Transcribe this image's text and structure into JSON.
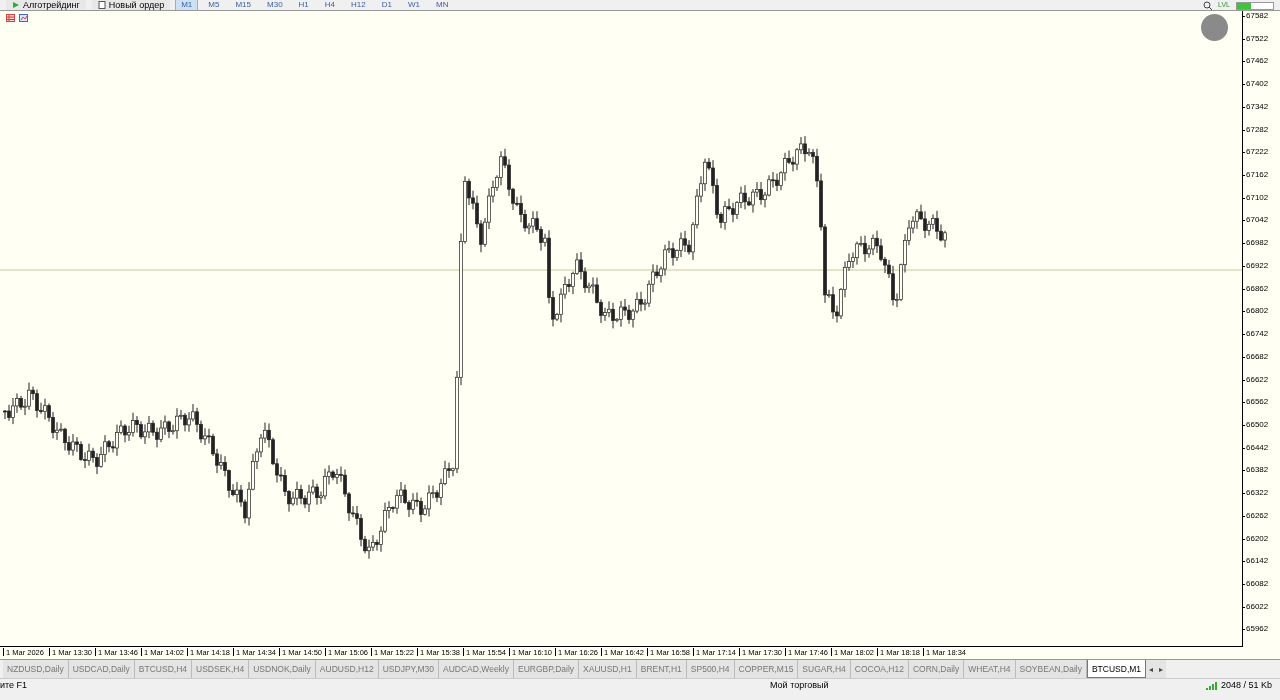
{
  "toolbar": {
    "buttons": [
      {
        "kind": "algo",
        "label": "Алготрейдинг"
      },
      {
        "kind": "order",
        "label": "Новый ордер"
      }
    ],
    "timeframes": [
      {
        "label": "M1",
        "selected": true
      },
      {
        "label": "M5",
        "selected": false
      },
      {
        "label": "M15",
        "selected": false
      },
      {
        "label": "M30",
        "selected": false
      },
      {
        "label": "H1",
        "selected": false
      },
      {
        "label": "H4",
        "selected": false
      },
      {
        "label": "H12",
        "selected": false
      },
      {
        "label": "D1",
        "selected": false
      },
      {
        "label": "W1",
        "selected": false
      },
      {
        "label": "MN",
        "selected": false
      }
    ],
    "indicator": "LVL"
  },
  "chart": {
    "price_ticks": [
      "67582",
      "67522",
      "67462",
      "67402",
      "67342",
      "67282",
      "67222",
      "67162",
      "67102",
      "67042",
      "66982",
      "66922",
      "66862",
      "66802",
      "66742",
      "66682",
      "66622",
      "66562",
      "66502",
      "66442",
      "66382",
      "66322",
      "66262",
      "66202",
      "66142",
      "66082",
      "66022",
      "65962"
    ],
    "time_ticks": [
      "1 Mar 2026",
      "1 Mar 13:30",
      "1 Mar 13:46",
      "1 Mar 14:02",
      "1 Mar 14:18",
      "1 Mar 14:34",
      "1 Mar 14:50",
      "1 Mar 15:06",
      "1 Mar 15:22",
      "1 Mar 15:38",
      "1 Mar 15:54",
      "1 Mar 16:10",
      "1 Mar 16:26",
      "1 Mar 16:42",
      "1 Mar 16:58",
      "1 Mar 17:14",
      "1 Mar 17:30",
      "1 Mar 17:46",
      "1 Mar 18:02",
      "1 Mar 18:18",
      "1 Mar 18:34"
    ]
  },
  "symbol_tabs": [
    {
      "label": "NZDUSD,Daily",
      "selected": false
    },
    {
      "label": "USDCAD,Daily",
      "selected": false
    },
    {
      "label": "BTCUSD,H4",
      "selected": false
    },
    {
      "label": "USDSEK,H4",
      "selected": false
    },
    {
      "label": "USDNOK,Daily",
      "selected": false
    },
    {
      "label": "AUDUSD,H12",
      "selected": false
    },
    {
      "label": "USDJPY,M30",
      "selected": false
    },
    {
      "label": "AUDCAD,Weekly",
      "selected": false
    },
    {
      "label": "EURGBP,Daily",
      "selected": false
    },
    {
      "label": "XAUUSD,H1",
      "selected": false
    },
    {
      "label": "BRENT,H1",
      "selected": false
    },
    {
      "label": "SP500,H4",
      "selected": false
    },
    {
      "label": "COPPER,M15",
      "selected": false
    },
    {
      "label": "SUGAR,H4",
      "selected": false
    },
    {
      "label": "COCOA,H12",
      "selected": false
    },
    {
      "label": "CORN,Daily",
      "selected": false
    },
    {
      "label": "WHEAT,H4",
      "selected": false
    },
    {
      "label": "SOYBEAN,Daily",
      "selected": false
    },
    {
      "label": "BTCUSD,M1",
      "selected": true
    }
  ],
  "tab_scroll": [
    "◂",
    "▸"
  ],
  "status_bar": {
    "help": "ите F1",
    "profile": "Мой торговый",
    "traffic": "2048 / 51 Kb"
  }
}
